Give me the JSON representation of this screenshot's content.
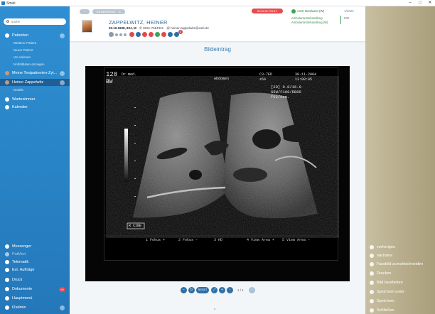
{
  "window": {
    "title": "Smiel",
    "min": "–",
    "max": "□",
    "close": "✕"
  },
  "search": {
    "placeholder": "suche"
  },
  "sidebar": {
    "patients": {
      "label": "Patienten"
    },
    "patient_subitems": [
      "Weiterer Patient",
      "Neuer Patient",
      "VK einlesen",
      "Notfalldaten anzeigen"
    ],
    "recent_patient_1": "Meine Testpatienten-Zyt...",
    "current_patient": "Heiner Zappelwitz",
    "current_sub": "Details",
    "waiting_room": "Wartezimmer",
    "calendar": "Kalender",
    "bottom": [
      {
        "label": "Messenger"
      },
      {
        "label": "PatMed"
      },
      {
        "label": "Telematik"
      },
      {
        "label": "Ext. Aufträge"
      },
      {
        "label": "Druck"
      },
      {
        "label": "Dokumente",
        "badge": "99"
      },
      {
        "label": "Hauptmenü"
      },
      {
        "label": "t2admin"
      }
    ]
  },
  "header": {
    "tab_back": "‹",
    "tab_label": "BILDEINTRAG",
    "tab_close": "✕",
    "patient_name": "ZAPPELWITZ, HEINER",
    "dob": "02.10.1938, 83J, M",
    "phone": "0631-7654321",
    "email": "heiner.zappelwitz@web.de",
    "alert_button": "SCHEIN FEHLT",
    "insurance": "AOK Nordwest (W)",
    "quarter": "1/2022",
    "ambulant_1": "Ambulante Behandlung",
    "ambulant_2": "Ambulante Behandlung (W)",
    "count": "002",
    "icon_badge": "2"
  },
  "content": {
    "title": "Bildeintrag",
    "image": {
      "top_left_1": "128",
      "top_left_2": "Dr.med.",
      "top_left_3": "BW",
      "top_center": "Abdomen",
      "top_mode": "C3-7ED",
      "top_date": "30-11-2004",
      "top_depth": "z64",
      "top_time": "13:00:05",
      "top_line3": "[2D] 0.0/16.0",
      "top_line4": "G5W/F100/DB95",
      "top_line5": "F02/Gen.",
      "cine_label": "R CINE",
      "softkeys": [
        "1  Fokus +",
        "2  Fokus –",
        "3  HD",
        "4 View Area +",
        "5 View Area –"
      ]
    },
    "pager": {
      "reset": "RESET",
      "page": "1 / 1"
    },
    "caret": "^"
  },
  "rightbar": {
    "actions": [
      "vorheriges",
      "nächstes",
      "Fassbild zurechtschneiden",
      "Drucken",
      "Bild bearbeiten",
      "Speichern unter",
      "Speichern",
      "Schließen"
    ]
  },
  "colors": {
    "sidebar_blue": "#2a86c9",
    "accent_blue": "#2e6fa6",
    "alert_red": "#e84b4b",
    "insurance_green": "#3aa55a",
    "rightbar_tan": "#b5ab89"
  }
}
